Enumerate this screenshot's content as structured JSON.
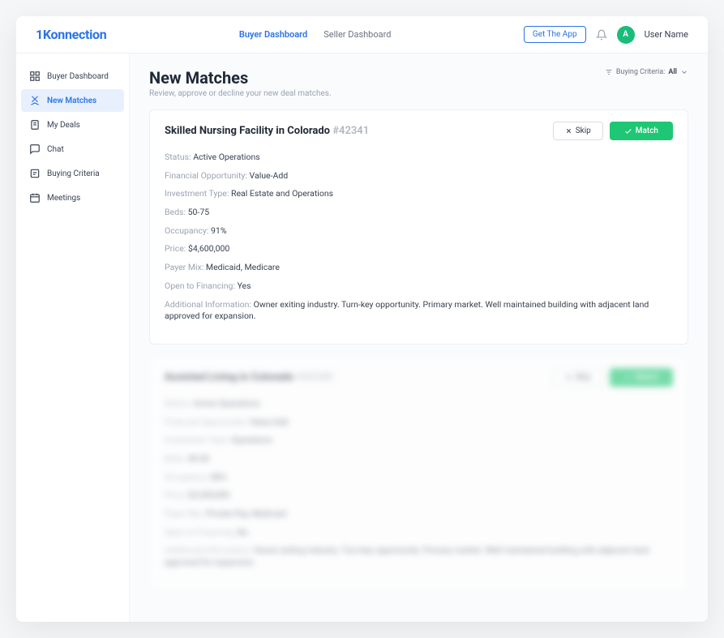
{
  "brand": "1Konnection",
  "header": {
    "tabs": {
      "buyer": "Buyer Dashboard",
      "seller": "Seller Dashboard"
    },
    "get_app": "Get The App",
    "avatar_letter": "A",
    "username": "User Name"
  },
  "sidebar": {
    "items": [
      {
        "label": "Buyer Dashboard"
      },
      {
        "label": "New Matches"
      },
      {
        "label": "My Deals"
      },
      {
        "label": "Chat"
      },
      {
        "label": "Buying Criteria"
      },
      {
        "label": "Meetings"
      }
    ]
  },
  "page": {
    "title": "New Matches",
    "subtitle": "Review, approve or decline your new deal matches.",
    "criteria_label": "Buying Criteria:",
    "criteria_value": "All"
  },
  "match": {
    "title": "Skilled Nursing Facility in Colorado",
    "deal_id": "#42341",
    "skip": "Skip",
    "match": "Match",
    "details": {
      "status_label": "Status:",
      "status_value": "Active Operations",
      "finopp_label": "Financial Opportunity:",
      "finopp_value": "Value-Add",
      "invtype_label": "Investment Type:",
      "invtype_value": "Real Estate and Operations",
      "beds_label": "Beds:",
      "beds_value": "50-75",
      "occ_label": "Occupancy:",
      "occ_value": "91%",
      "price_label": "Price:",
      "price_value": "$4,600,000",
      "payer_label": "Payer Mix:",
      "payer_value": "Medicaid, Medicare",
      "openfin_label": "Open to Financing:",
      "openfin_value": "Yes",
      "addl_label": "Additional Information:",
      "addl_value": "Owner exiting industry. Turn-key opportunity. Primary market. Well maintained building with adjacent land approved for expansion."
    }
  },
  "match2": {
    "title": "Assisted Living in Colorado",
    "deal_id": "#42340",
    "skip": "Skip",
    "match": "Match",
    "details": {
      "status_label": "Status:",
      "status_value": "Active Operations",
      "finopp_label": "Financial Opportunity:",
      "finopp_value": "Value-Add",
      "invtype_label": "Investment Type:",
      "invtype_value": "Operations",
      "beds_label": "Beds:",
      "beds_value": "40-60",
      "occ_label": "Occupancy:",
      "occ_value": "88%",
      "price_label": "Price:",
      "price_value": "$3,200,000",
      "payer_label": "Payer Mix:",
      "payer_value": "Private Pay, Medicaid",
      "openfin_label": "Open to Financing:",
      "openfin_value": "No",
      "addl_label": "Additional Information:",
      "addl_value": "Owner exiting industry. Turn-key opportunity. Primary market. Well maintained building with adjacent land approved for expansion."
    }
  }
}
